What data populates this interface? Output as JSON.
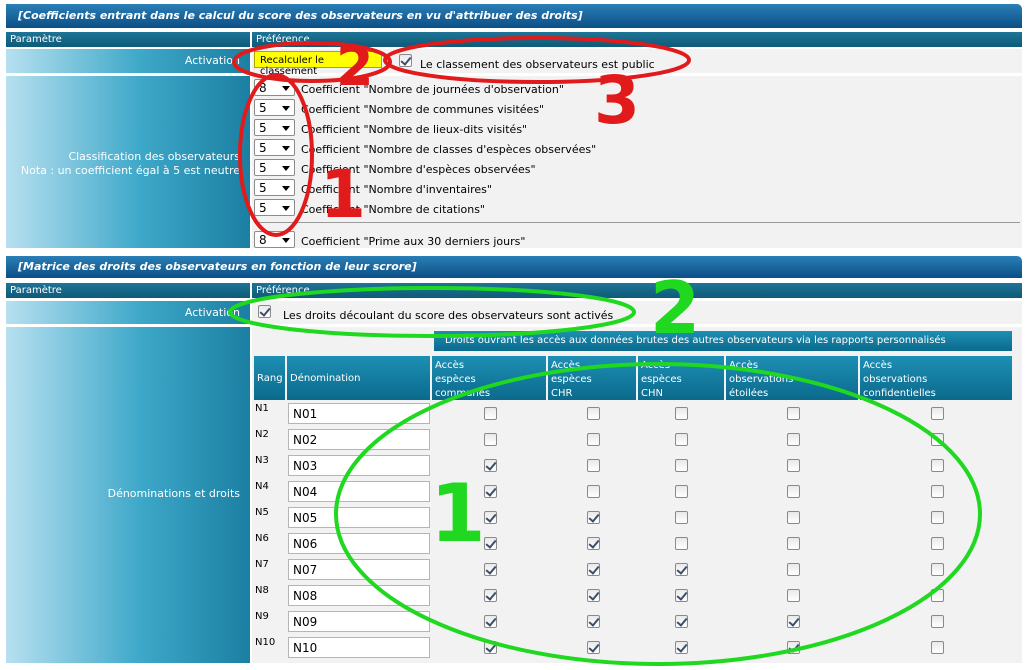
{
  "section1": {
    "title": "[Coefficients entrant dans le calcul du score des observateurs en vu d'attribuer des droits]",
    "param_header": "Paramètre",
    "pref_header": "Préférence",
    "activation_label": "Activation",
    "recalc_button": "Recalculer le classement",
    "public_checkbox_label": "Le classement des observateurs est public",
    "public_checked": true,
    "classification_label_line1": "Classification des observateurs",
    "classification_label_line2": "Nota : un coefficient égal à 5 est neutre",
    "coefficients": [
      {
        "value": "8",
        "label": "Coefficient \"Nombre de journées d'observation\""
      },
      {
        "value": "5",
        "label": "Coefficient \"Nombre de communes visitées\""
      },
      {
        "value": "5",
        "label": "Coefficient \"Nombre de lieux-dits visités\""
      },
      {
        "value": "5",
        "label": "Coefficient \"Nombre de classes d'espèces observées\""
      },
      {
        "value": "5",
        "label": "Coefficient \"Nombre d'espèces observées\""
      },
      {
        "value": "5",
        "label": "Coefficient \"Nombre d'inventaires\""
      },
      {
        "value": "5",
        "label": "Coefficient \"Nombre de citations\""
      }
    ],
    "prime": {
      "value": "8",
      "label": "Coefficient \"Prime aux 30 derniers jours\""
    }
  },
  "section2": {
    "title": "[Matrice des droits des observateurs en fonction de leur scrore]",
    "param_header": "Paramètre",
    "pref_header": "Préférence",
    "activation_label": "Activation",
    "rights_checkbox_label": "Les droits découlant du score des observateurs sont activés",
    "rights_checked": true,
    "denominations_label": "Dénominations et droits",
    "rights_group_header": "Droits ouvrant les accès aux données brutes des autres observateurs via les rapports personnalisés",
    "col_rang": "Rang",
    "col_denomination": "Dénomination",
    "access_columns": [
      [
        "Accès",
        "espèces",
        "communes"
      ],
      [
        "Accès",
        "espèces",
        "CHR"
      ],
      [
        "Accès",
        "espèces",
        "CHN"
      ],
      [
        "Accès",
        "observations",
        "étoilées"
      ],
      [
        "Accès",
        "observations",
        "confidentielles"
      ]
    ],
    "rows": [
      {
        "rank": "N1",
        "name": "N01",
        "checks": [
          false,
          false,
          false,
          false,
          false
        ]
      },
      {
        "rank": "N2",
        "name": "N02",
        "checks": [
          false,
          false,
          false,
          false,
          false
        ]
      },
      {
        "rank": "N3",
        "name": "N03",
        "checks": [
          true,
          false,
          false,
          false,
          false
        ]
      },
      {
        "rank": "N4",
        "name": "N04",
        "checks": [
          true,
          false,
          false,
          false,
          false
        ]
      },
      {
        "rank": "N5",
        "name": "N05",
        "checks": [
          true,
          true,
          false,
          false,
          false
        ]
      },
      {
        "rank": "N6",
        "name": "N06",
        "checks": [
          true,
          true,
          false,
          false,
          false
        ]
      },
      {
        "rank": "N7",
        "name": "N07",
        "checks": [
          true,
          true,
          true,
          false,
          false
        ]
      },
      {
        "rank": "N8",
        "name": "N08",
        "checks": [
          true,
          true,
          true,
          false,
          false
        ]
      },
      {
        "rank": "N9",
        "name": "N09",
        "checks": [
          true,
          true,
          true,
          true,
          false
        ]
      },
      {
        "rank": "N10",
        "name": "N10",
        "checks": [
          true,
          true,
          true,
          true,
          false
        ]
      }
    ]
  },
  "annotations": {
    "red_1": "1",
    "red_2": "2",
    "red_3": "3",
    "green_1": "1",
    "green_2": "2",
    "red_color": "#e11b1b",
    "green_color": "#1fd81f"
  }
}
